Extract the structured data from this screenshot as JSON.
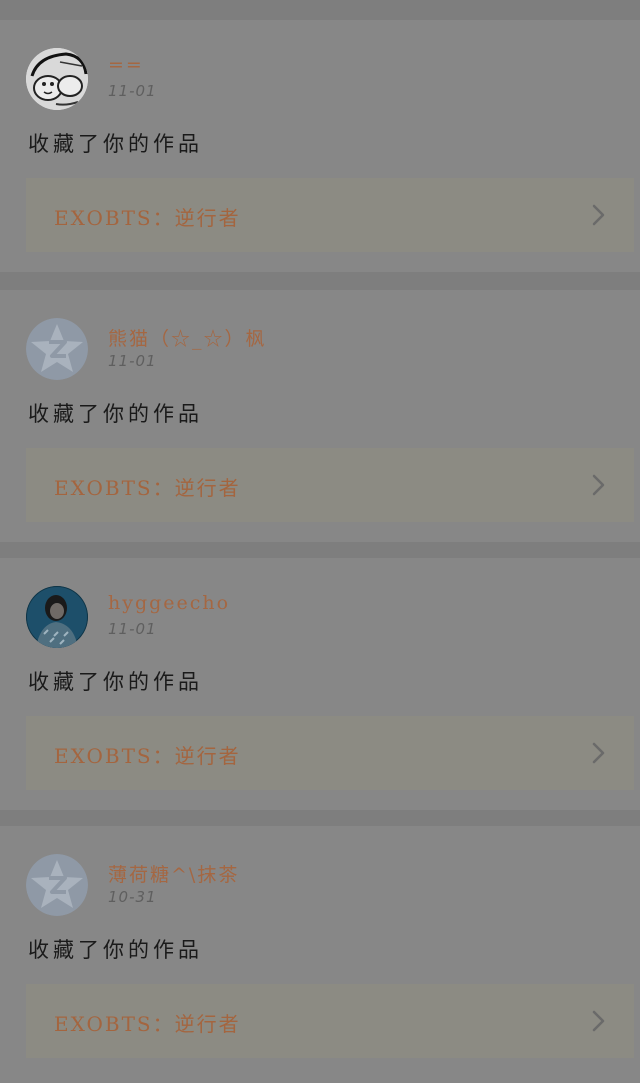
{
  "notifications": [
    {
      "username": "==",
      "date": "11-01",
      "action": "收藏了你的作品",
      "work_title": "EXOBTS：逆行者",
      "avatar_type": "hand-drawn-doodle",
      "chevron_icon": "chevron-right-icon"
    },
    {
      "username": "熊猫（☆_☆）枫",
      "date": "11-01",
      "action": "收藏了你的作品",
      "work_title": "EXOBTS：逆行者",
      "avatar_type": "default-qq-star",
      "chevron_icon": "chevron-right-icon"
    },
    {
      "username": "hyggeecho",
      "date": "11-01",
      "action": "收藏了你的作品",
      "work_title": "EXOBTS：逆行者",
      "avatar_type": "photo-portrait",
      "chevron_icon": "chevron-right-icon"
    },
    {
      "username": "薄荷糖^\\抹茶",
      "date": "10-31",
      "action": "收藏了你的作品",
      "work_title": "EXOBTS：逆行者",
      "avatar_type": "default-qq-star",
      "chevron_icon": "chevron-right-icon"
    }
  ],
  "colors": {
    "username": "#a56742",
    "work_title": "#a4653f",
    "card_background": "#878787",
    "link_background": "#8c8b83",
    "action_text": "#1a1a1a"
  }
}
